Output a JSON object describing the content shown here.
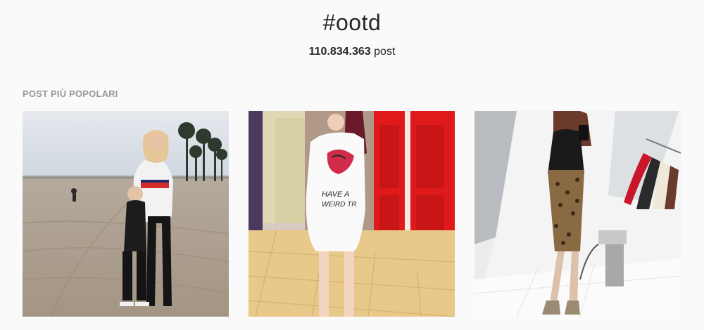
{
  "hashtag": {
    "title": "#ootd",
    "post_count": "110.834.363",
    "post_suffix": "post"
  },
  "sections": {
    "top_posts_label": "POST PIÙ POPOLARI"
  },
  "posts": [
    {
      "description": "beach-photo"
    },
    {
      "description": "red-door-photo"
    },
    {
      "description": "mirror-selfie-photo"
    }
  ],
  "colors": {
    "text": "#262626",
    "muted": "#999999",
    "background": "#fafafa"
  }
}
